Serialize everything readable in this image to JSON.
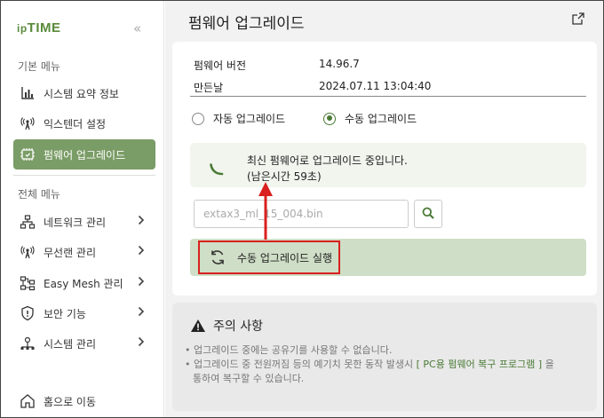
{
  "sidebar": {
    "logo_small": "ip",
    "logo_big": "TIME",
    "collapse": "«",
    "basic_menu_title": "기본 메뉴",
    "basic_items": [
      {
        "label": "시스템 요약 정보",
        "icon": "bar-chart-icon"
      },
      {
        "label": "익스텐더 설정",
        "icon": "antenna-icon"
      },
      {
        "label": "펌웨어 업그레이드",
        "icon": "firmware-icon"
      }
    ],
    "all_menu_title": "전체 메뉴",
    "all_items": [
      {
        "label": "네트워크 관리",
        "icon": "network-icon"
      },
      {
        "label": "무선랜 관리",
        "icon": "wireless-icon"
      },
      {
        "label": "Easy Mesh 관리",
        "icon": "mesh-icon"
      },
      {
        "label": "보안 기능",
        "icon": "shield-icon"
      },
      {
        "label": "시스템 관리",
        "icon": "system-icon"
      }
    ],
    "home": "홈으로 이동"
  },
  "main": {
    "title": "펌웨어 업그레이드",
    "info": {
      "version_label": "펌웨어 버전",
      "version_value": "14.96.7",
      "date_label": "만든날",
      "date_value": "2024.07.11 13:04:40"
    },
    "radio_auto": "자동 업그레이드",
    "radio_manual": "수동 업그레이드",
    "selected_mode": "manual",
    "status_line1": "최신 펌웨어로 업그레이드 중입니다.",
    "status_line2": "(남은시간 59초)",
    "file_placeholder": "extax3_ml_15_004.bin",
    "run_label": "수동 업그레이드 실행"
  },
  "notice": {
    "title": "주의 사항",
    "line1": "• 업그레이드 중에는 공유기를 사용할 수 없습니다.",
    "line2_prefix": "• 업그레이드 중 전원꺼짐 등의 예기치 못한 동작 발생시 ",
    "line2_link": "[ PC용 펌웨어 복구 프로그램 ]",
    "line2_suffix": " 을",
    "line3": "통하여 복구할 수 있습니다."
  },
  "colors": {
    "accent": "#7a9c66",
    "accent_dark": "#4a7a35",
    "highlight_red": "#d9201e",
    "run_bar": "#cfdec6"
  }
}
